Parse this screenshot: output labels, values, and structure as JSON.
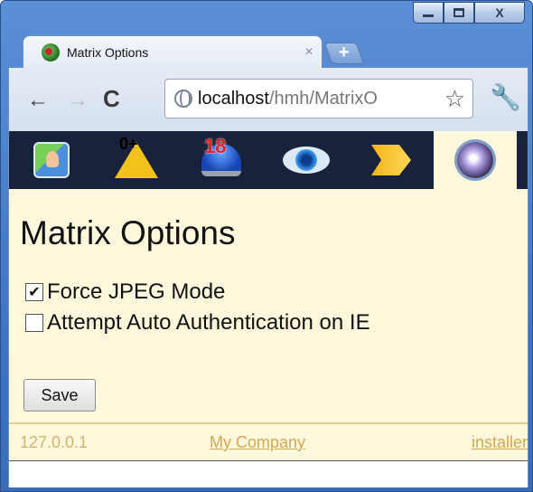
{
  "tab": {
    "title": "Matrix Options",
    "close": "×"
  },
  "new_tab": {
    "label": "+"
  },
  "nav": {
    "back": "←",
    "forward": "→",
    "reload": "C"
  },
  "address": {
    "host": "localhost",
    "path": "/hmh/MatrixO"
  },
  "toolbar": {
    "star_glyph": "☆",
    "wrench_glyph": "🔧"
  },
  "caption": {
    "close": "X"
  },
  "iconbar": {
    "items": [
      {
        "name": "switch-user-icon",
        "label": ""
      },
      {
        "name": "warning-icon",
        "label": "0+"
      },
      {
        "name": "alarm-icon",
        "label": "18"
      },
      {
        "name": "eye-icon",
        "label": ""
      },
      {
        "name": "forward-icon",
        "label": ""
      },
      {
        "name": "settings-icon",
        "label": ""
      }
    ]
  },
  "page": {
    "heading": "Matrix Options",
    "options": [
      {
        "label": "Force JPEG Mode",
        "checked": true
      },
      {
        "label": "Attempt Auto Authentication on IE",
        "checked": false
      }
    ],
    "save_label": "Save"
  },
  "footer": {
    "ip": "127.0.0.1",
    "company": "My Company",
    "installer": "installer"
  },
  "colors": {
    "page_bg": "#fff8dc",
    "iconbar_bg": "#18223a",
    "footer_text": "#d4a850"
  }
}
